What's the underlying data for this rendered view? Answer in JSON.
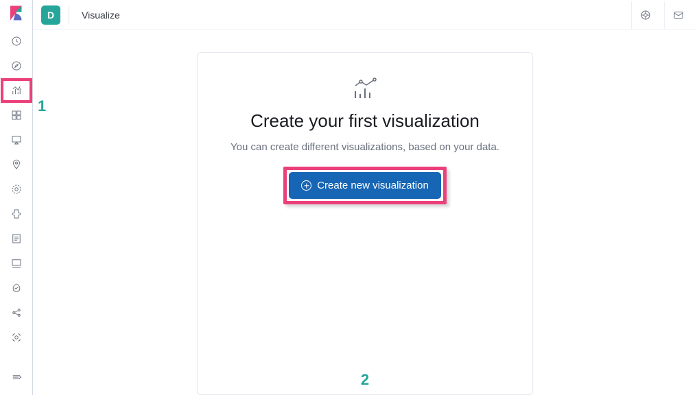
{
  "header": {
    "space_initial": "D",
    "breadcrumb": "Visualize"
  },
  "sidebar": {
    "items": [
      {
        "name": "recently-viewed",
        "icon": "clock"
      },
      {
        "name": "discover",
        "icon": "compass"
      },
      {
        "name": "visualize",
        "icon": "bar-chart",
        "active": true
      },
      {
        "name": "dashboard",
        "icon": "dashboard"
      },
      {
        "name": "canvas",
        "icon": "canvas"
      },
      {
        "name": "maps",
        "icon": "pin"
      },
      {
        "name": "machine-learning",
        "icon": "ml"
      },
      {
        "name": "infrastructure",
        "icon": "infra"
      },
      {
        "name": "logs",
        "icon": "logs"
      },
      {
        "name": "apm",
        "icon": "apm"
      },
      {
        "name": "uptime",
        "icon": "uptime"
      },
      {
        "name": "siem",
        "icon": "siem"
      },
      {
        "name": "stack-monitoring",
        "icon": "monitoring"
      }
    ]
  },
  "card": {
    "title": "Create your first visualization",
    "subtitle": "You can create different visualizations, based on your data.",
    "button_label": "Create new visualization"
  },
  "annotations": {
    "one": "1",
    "two": "2"
  }
}
